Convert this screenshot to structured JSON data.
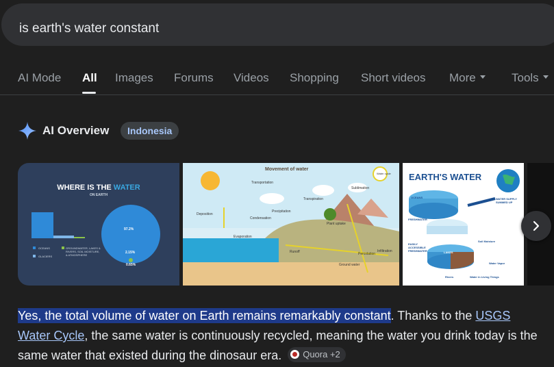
{
  "search": {
    "query": "is earth's water constant"
  },
  "tabs": [
    {
      "label": "AI Mode"
    },
    {
      "label": "All"
    },
    {
      "label": "Images"
    },
    {
      "label": "Forums"
    },
    {
      "label": "Videos"
    },
    {
      "label": "Shopping"
    },
    {
      "label": "Short videos"
    },
    {
      "label": "More"
    },
    {
      "label": "Tools"
    }
  ],
  "ai_overview": {
    "title": "AI Overview",
    "location_chip": "Indonesia"
  },
  "images": {
    "card1": {
      "title_prefix": "WHERE IS THE ",
      "title_highlight": "WATER",
      "subtitle": "ON EARTH",
      "legend": [
        "OCEANS",
        "GLACIERS",
        "GROUNDWATER, LAKES & RIVERS, SOIL MOISTURE, & ATMOSPHERE"
      ],
      "pct_main": "97.2%",
      "pct_glaciers": "2.15%",
      "pct_other": "0.65%"
    },
    "card2": {
      "title": "Movement of water",
      "labels": [
        "Transportation",
        "Deposition",
        "Precipitation",
        "Condensation",
        "Evaporation",
        "Transpiration",
        "Plant uptake",
        "Runoff",
        "Sublimation",
        "Percolation",
        "Infiltration",
        "Ground water",
        "Water cycle"
      ]
    },
    "card3": {
      "title": "EARTH'S WATER",
      "labels": [
        "OCEANS",
        "FRESHWATER",
        "EASILY ACCESSIBLE FRESHWATER",
        "WATER SUPPLY SUMMED UP",
        "LAKES",
        "Soil Moisture",
        "Water Vapor",
        "Rivers",
        "Water in Living Things"
      ]
    }
  },
  "answer": {
    "highlight": "Yes, the total volume of water on Earth remains remarkably constant",
    "part1": ". Thanks to the ",
    "link": "USGS Water Cycle",
    "part2": ", the same water is continuously recycled, meaning the water you drink today is the same water that existed during the dinosaur era. ",
    "source": "Quora +2"
  },
  "colors": {
    "background": "#1f1f1f",
    "search_bar": "#303134",
    "highlight": "#1e3a8a",
    "link": "#a8c7fa",
    "chip_text": "#a8c7fa"
  }
}
